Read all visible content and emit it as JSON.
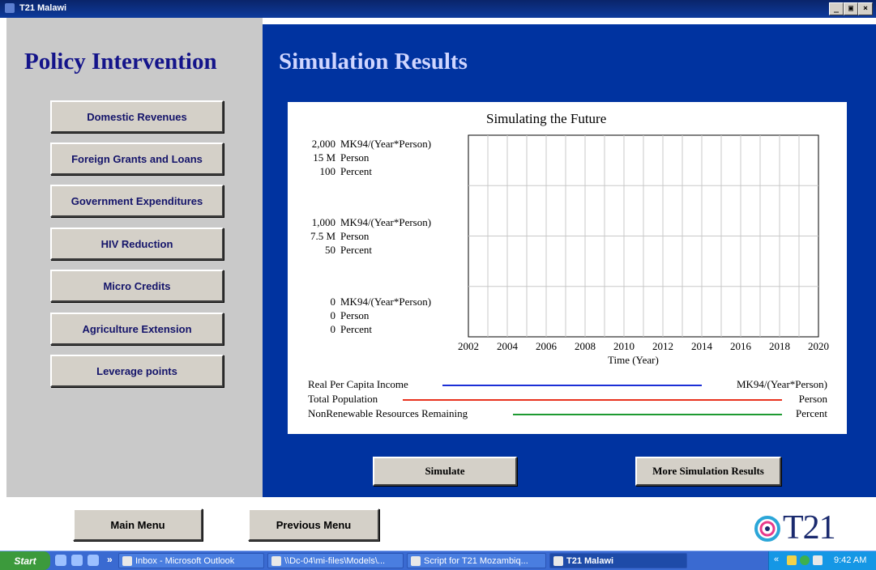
{
  "window": {
    "title": "T21 Malawi",
    "min_label": "_",
    "max_label": "▣",
    "close_label": "×"
  },
  "headings": {
    "policy": "Policy Intervention",
    "simulation": "Simulation Results"
  },
  "left_buttons": [
    "Domestic Revenues",
    "Foreign Grants and Loans",
    "Government Expenditures",
    "HIV Reduction",
    "Micro Credits",
    "Agriculture Extension",
    "Leverage points"
  ],
  "actions": {
    "simulate": "Simulate",
    "more_results": "More Simulation Results"
  },
  "bottom_buttons": {
    "main_menu": "Main Menu",
    "previous_menu": "Previous Menu"
  },
  "logo": {
    "text": "T21"
  },
  "chart_data": {
    "type": "line",
    "title": "Simulating the Future",
    "xlabel": "Time (Year)",
    "x_ticks": [
      "2002",
      "2004",
      "2006",
      "2008",
      "2010",
      "2012",
      "2014",
      "2016",
      "2018",
      "2020"
    ],
    "xlim": [
      2002,
      2020
    ],
    "y_axes": [
      {
        "ticks": [
          "2,000",
          "1,000",
          "0"
        ],
        "unit": "MK94/(Year*Person)",
        "ylim": [
          0,
          2000
        ]
      },
      {
        "ticks": [
          "15 M",
          "7.5 M",
          "0"
        ],
        "unit": "Person",
        "ylim": [
          0,
          15000000
        ]
      },
      {
        "ticks": [
          "100",
          "50",
          "0"
        ],
        "unit": "Percent",
        "ylim": [
          0,
          100
        ]
      }
    ],
    "series": [
      {
        "name": "Real Per Capita Income",
        "unit": "MK94/(Year*Person)",
        "color": "#1c2fd6",
        "values": []
      },
      {
        "name": "Total Population",
        "unit": "Person",
        "color": "#e8321e",
        "values": []
      },
      {
        "name": "NonRenewable Resources Remaining",
        "unit": "Percent",
        "color": "#1e9a32",
        "values": []
      }
    ],
    "grid": true
  },
  "taskbar": {
    "start": "Start",
    "chevron": "»",
    "items": [
      "Inbox - Microsoft Outlook",
      "\\\\Dc-04\\mi-files\\Models\\...",
      "Script for T21 Mozambiq...",
      "T21 Malawi"
    ],
    "tray_chevron": "«",
    "clock": "9:42 AM"
  }
}
